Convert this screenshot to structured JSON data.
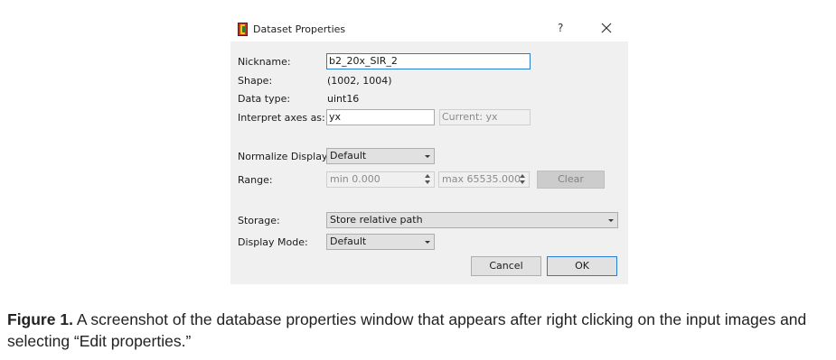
{
  "window": {
    "title": "Dataset Properties",
    "icon": "app-icon",
    "help_label": "?",
    "close_icon": "close-icon"
  },
  "fields": {
    "nickname_label": "Nickname:",
    "nickname_value": "b2_20x_SIR_2",
    "shape_label": "Shape:",
    "shape_value": "(1002, 1004)",
    "dtype_label": "Data type:",
    "dtype_value": "uint16",
    "axes_label": "Interpret axes as:",
    "axes_value": "yx",
    "axes_current": "Current: yx",
    "normalize_label": "Normalize Display:",
    "normalize_value": "Default",
    "range_label": "Range:",
    "range_min": "min 0.000",
    "range_max": "max 65535.000",
    "clear_label": "Clear",
    "storage_label": "Storage:",
    "storage_value": "Store relative path",
    "display_mode_label": "Display Mode:",
    "display_mode_value": "Default"
  },
  "buttons": {
    "cancel": "Cancel",
    "ok": "OK"
  },
  "caption": {
    "prefix": "Figure 1.",
    "text": " A screenshot of the database properties window that appears after right clicking on the input images and selecting “Edit properties.”"
  }
}
